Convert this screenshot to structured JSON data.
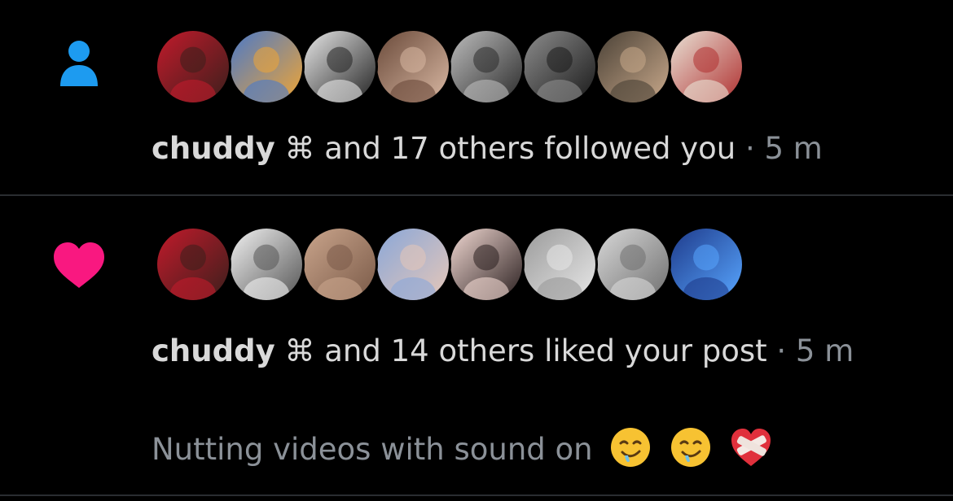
{
  "colors": {
    "background": "#000000",
    "divider": "#2a2d31",
    "follow_icon": "#1d9bf0",
    "like_icon": "#f91880",
    "primary_text": "#d9d9d9",
    "secondary_text": "#8b9198"
  },
  "notifications": [
    {
      "type": "follow",
      "icon": "person-icon",
      "avatars": [
        {
          "name": "avatar-1",
          "colors": [
            "#c21a2b",
            "#3b1f1c"
          ]
        },
        {
          "name": "avatar-2",
          "colors": [
            "#4a79c9",
            "#f0a534"
          ]
        },
        {
          "name": "avatar-3",
          "colors": [
            "#e8e8e8",
            "#222222"
          ]
        },
        {
          "name": "avatar-4",
          "colors": [
            "#6a4a3a",
            "#d9b8a3"
          ]
        },
        {
          "name": "avatar-5",
          "colors": [
            "#bdbdbd",
            "#2b2b2b"
          ]
        },
        {
          "name": "avatar-6",
          "colors": [
            "#8d8d8d",
            "#1a1a1a"
          ]
        },
        {
          "name": "avatar-7",
          "colors": [
            "#4a4136",
            "#c9a98b"
          ]
        },
        {
          "name": "avatar-8",
          "colors": [
            "#e9e2d6",
            "#b03030"
          ]
        }
      ],
      "actor": "chuddy",
      "actor_glyph": "⌘",
      "action": " and 17 others followed you",
      "time": " · 5 m"
    },
    {
      "type": "like",
      "icon": "heart-icon",
      "avatars": [
        {
          "name": "avatar-1",
          "colors": [
            "#c21a2b",
            "#3b1f1c"
          ]
        },
        {
          "name": "avatar-2",
          "colors": [
            "#f2f2f2",
            "#555555"
          ]
        },
        {
          "name": "avatar-3",
          "colors": [
            "#caa58c",
            "#7a5a48"
          ]
        },
        {
          "name": "avatar-4",
          "colors": [
            "#8aa7d8",
            "#e6c7b8"
          ]
        },
        {
          "name": "avatar-5",
          "colors": [
            "#f1d8d2",
            "#2a1f1f"
          ]
        },
        {
          "name": "avatar-6",
          "colors": [
            "#9a9a9a",
            "#e8e8e8"
          ]
        },
        {
          "name": "avatar-7",
          "colors": [
            "#d8d8d8",
            "#707070"
          ]
        },
        {
          "name": "avatar-8",
          "colors": [
            "#1e3a8a",
            "#58a6ff"
          ]
        }
      ],
      "actor": "chuddy",
      "actor_glyph": "⌘",
      "action": " and 14 others liked your post",
      "time": " · 5 m",
      "post_preview": "Nutting videos with sound on"
    }
  ]
}
